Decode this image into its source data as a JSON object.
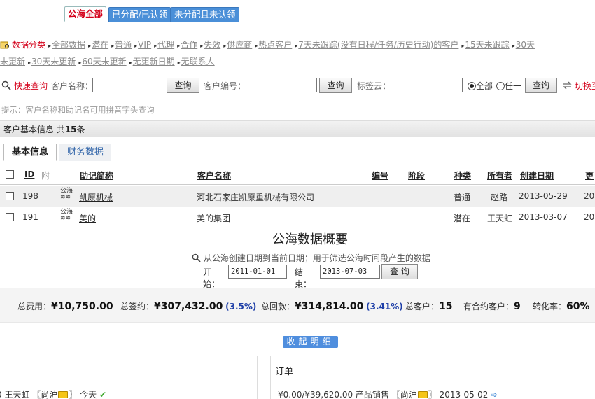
{
  "tabs": [
    "公海全部",
    "已分配/已认领",
    "未分配且未认领"
  ],
  "categories": {
    "label": "数据分类",
    "row1": [
      "全部数据",
      "潜在",
      "普通",
      "VIP",
      "代理",
      "合作",
      "失效",
      "供应商",
      "热点客户",
      "7天未跟踪(没有日程/任务/历史行动)的客户",
      "15天未跟踪",
      "30天"
    ],
    "row2_lead": "未更新",
    "row2": [
      "30天未更新",
      "60天未更新",
      "无更新日期",
      "无联系人"
    ]
  },
  "query": {
    "label": "快速查询",
    "name_label": "客户名称：",
    "no_label": "客户编号：",
    "tag_label": "标签云：",
    "btn": "查询",
    "radio_all": "全部",
    "radio_any": "任一",
    "switch": "切换至"
  },
  "hint": "提示：客户名称和助记名可用拼音字头查询",
  "basic": {
    "prefix": "客户基本信息  共",
    "count": "15",
    "suffix": "条"
  },
  "subtabs": [
    "基本信息",
    "财务数据"
  ],
  "table": {
    "headers": [
      "ID",
      "附",
      "助记简称",
      "客户名称",
      "编号",
      "阶段",
      "种类",
      "所有者",
      "创建日期",
      "更"
    ],
    "rows": [
      {
        "id": "198",
        "icon": "公海",
        "short": "凯原机械",
        "name": "河北石家庄凯原重机械有限公司",
        "kind": "普通",
        "owner": "赵路",
        "date": "2013-05-29",
        "trail": "20"
      },
      {
        "id": "191",
        "icon": "公海",
        "short": "美的",
        "name": "美的集团",
        "kind": "潜在",
        "owner": "王天虹",
        "date": "2013-03-07",
        "trail": "20"
      }
    ]
  },
  "overview": {
    "title": "公海数据概要",
    "subtitle": "从公海创建日期到当前日期；用于筛选公海时间段产生的数据",
    "start_label": "开始：",
    "start": "2011-01-01",
    "end_label": "结束：",
    "end": "2013-07-03",
    "btn": "查 询",
    "stats": {
      "fee_label": "总费用：",
      "fee": "¥10,750.00",
      "sign_label": "总签约：",
      "sign": "¥307,432.00",
      "sign_pct": "(3.5%)",
      "back_label": "总回款：",
      "back": "¥314,814.00",
      "back_pct": "(3.41%)",
      "cust_label": "总客户：",
      "cust": "15",
      "contract_label": "有合约客户：",
      "contract": "9",
      "rate_label": "转化率：",
      "rate": "60%"
    },
    "collapse": "收起明细",
    "left_line": {
      "name": "王天虹",
      "tag": "〖尚沪",
      "tag_end": "〗",
      "when": "今天"
    },
    "right": {
      "title": "订单",
      "line": "¥0.00/¥39,620.00 产品销售",
      "tag": "〖尚沪",
      "tag_end": "〗",
      "date": "2013-05-02"
    }
  }
}
